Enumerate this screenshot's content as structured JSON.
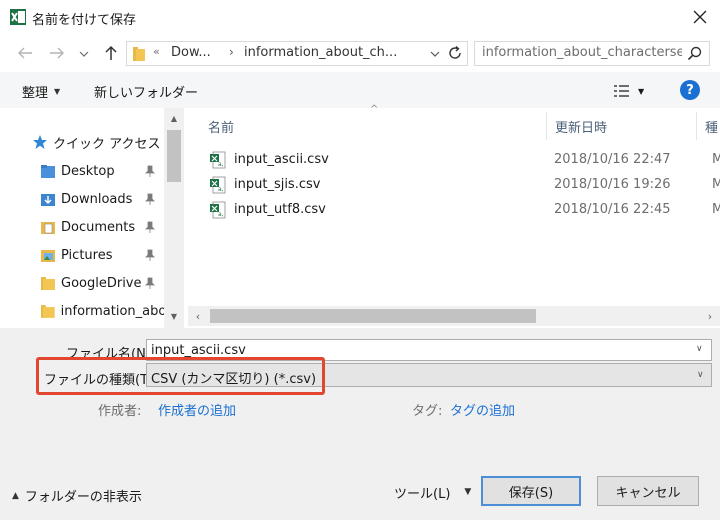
{
  "window": {
    "title": "名前を付けて保存"
  },
  "address": {
    "overflow": "«",
    "segment1": "Dow...",
    "segment2": "information_about_ch...",
    "separator": "›"
  },
  "search": {
    "placeholder": "information_about_characterse..."
  },
  "toolbar": {
    "organize": "整理",
    "new_folder": "新しいフォルダー"
  },
  "nav": {
    "quick_access": "クイック アクセス",
    "items": [
      {
        "label": "Desktop",
        "icon": "desktop-folder-icon",
        "pinned": true
      },
      {
        "label": "Downloads",
        "icon": "downloads-folder-icon",
        "pinned": true
      },
      {
        "label": "Documents",
        "icon": "documents-folder-icon",
        "pinned": true
      },
      {
        "label": "Pictures",
        "icon": "pictures-folder-icon",
        "pinned": true
      },
      {
        "label": "GoogleDrive",
        "icon": "folder-icon",
        "pinned": true
      },
      {
        "label": "information_abo",
        "icon": "folder-icon",
        "pinned": false
      }
    ]
  },
  "files": {
    "columns": {
      "name": "名前",
      "date": "更新日時",
      "type": "種"
    },
    "rows": [
      {
        "name": "input_ascii.csv",
        "date": "2018/10/16 22:47",
        "type": "M"
      },
      {
        "name": "input_sjis.csv",
        "date": "2018/10/16 19:26",
        "type": "M"
      },
      {
        "name": "input_utf8.csv",
        "date": "2018/10/16 22:45",
        "type": "M"
      }
    ]
  },
  "form": {
    "filename_label": "ファイル名(N):",
    "filename_value": "input_ascii.csv",
    "filetype_label": "ファイルの種類(T):",
    "filetype_value": "CSV (カンマ区切り) (*.csv)",
    "authors_label": "作成者:",
    "authors_link": "作成者の追加",
    "tags_label": "タグ:",
    "tags_link": "タグの追加"
  },
  "footer": {
    "hide_folders": "フォルダーの非表示",
    "tools": "ツール(L)",
    "save": "保存(S)",
    "cancel": "キャンセル"
  },
  "colors": {
    "accent": "#1a6fd3",
    "highlight": "#e2462f",
    "excel_green": "#1e7145"
  }
}
